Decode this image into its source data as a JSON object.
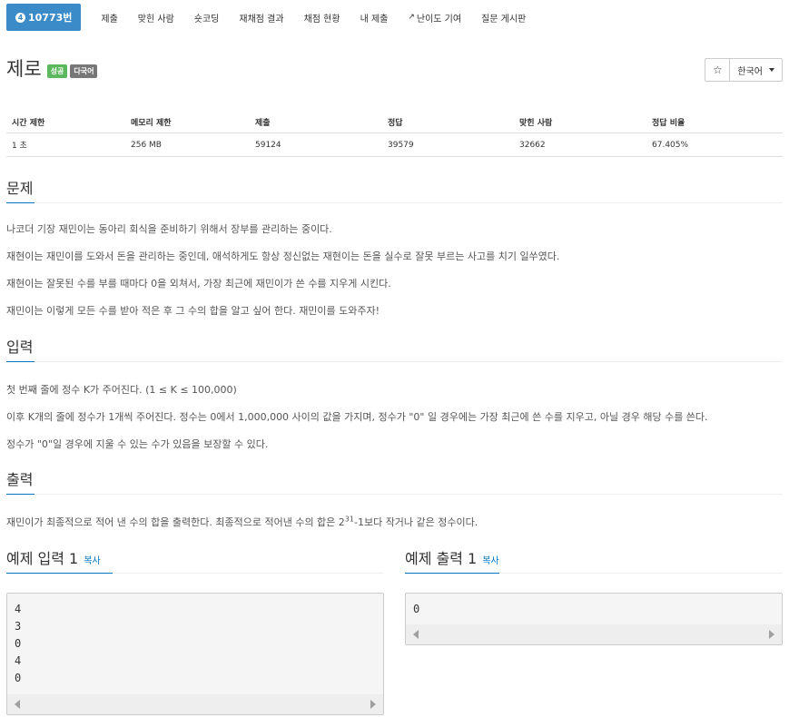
{
  "nav": {
    "problem_tier": "4",
    "problem_number": "10773번",
    "items": [
      "제출",
      "맞힌 사람",
      "숏코딩",
      "재채점 결과",
      "채점 현황",
      "내 제출",
      "난이도 기여",
      "질문 게시판"
    ]
  },
  "problem": {
    "title": "제로",
    "label_success": "성공",
    "label_multilang": "다국어",
    "lang_button": "한국어",
    "star": "☆"
  },
  "info_table": {
    "headers": [
      "시간 제한",
      "메모리 제한",
      "제출",
      "정답",
      "맞힌 사람",
      "정답 비율"
    ],
    "values": [
      "1 초",
      "256 MB",
      "59124",
      "39579",
      "32662",
      "67.405%"
    ]
  },
  "sections": {
    "description": {
      "title": "문제",
      "paragraphs": [
        "나코더 기장 재민이는 동아리 회식을 준비하기 위해서 장부를 관리하는 중이다.",
        "재현이는 재민이를 도와서 돈을 관리하는 중인데, 애석하게도 항상 정신없는 재현이는 돈을 실수로 잘못 부르는 사고를 치기 일쑤였다.",
        "재현이는 잘못된 수를 부를 때마다 0을 외쳐서, 가장 최근에 재민이가 쓴 수를 지우게 시킨다.",
        "재민이는 이렇게 모든 수를 받아 적은 후 그 수의 합을 알고 싶어 한다. 재민이를 도와주자!"
      ]
    },
    "input": {
      "title": "입력",
      "paragraphs": [
        "첫 번째 줄에 정수 K가 주어진다. (1 ≤ K ≤ 100,000)",
        "이후 K개의 줄에 정수가 1개씩 주어진다. 정수는 0에서 1,000,000 사이의 값을 가지며, 정수가 \"0\" 일 경우에는 가장 최근에 쓴 수를 지우고, 아닐 경우 해당 수를 쓴다.",
        "정수가 \"0\"일 경우에 지울 수 있는 수가 있음을 보장할 수 있다."
      ]
    },
    "output": {
      "title": "출력",
      "text_before": "재민이가 최종적으로 적어 낸 수의 합을 출력한다. 최종적으로 적어낸 수의 합은 2",
      "sup": "31",
      "text_after": "-1보다 작거나 같은 정수이다."
    }
  },
  "samples": {
    "input": {
      "title": "예제 입력 1",
      "copy": "복사",
      "lines": [
        "4",
        "3",
        "0",
        "4",
        "0"
      ]
    },
    "output": {
      "title": "예제 출력 1",
      "copy": "복사",
      "lines": [
        "0"
      ]
    }
  }
}
